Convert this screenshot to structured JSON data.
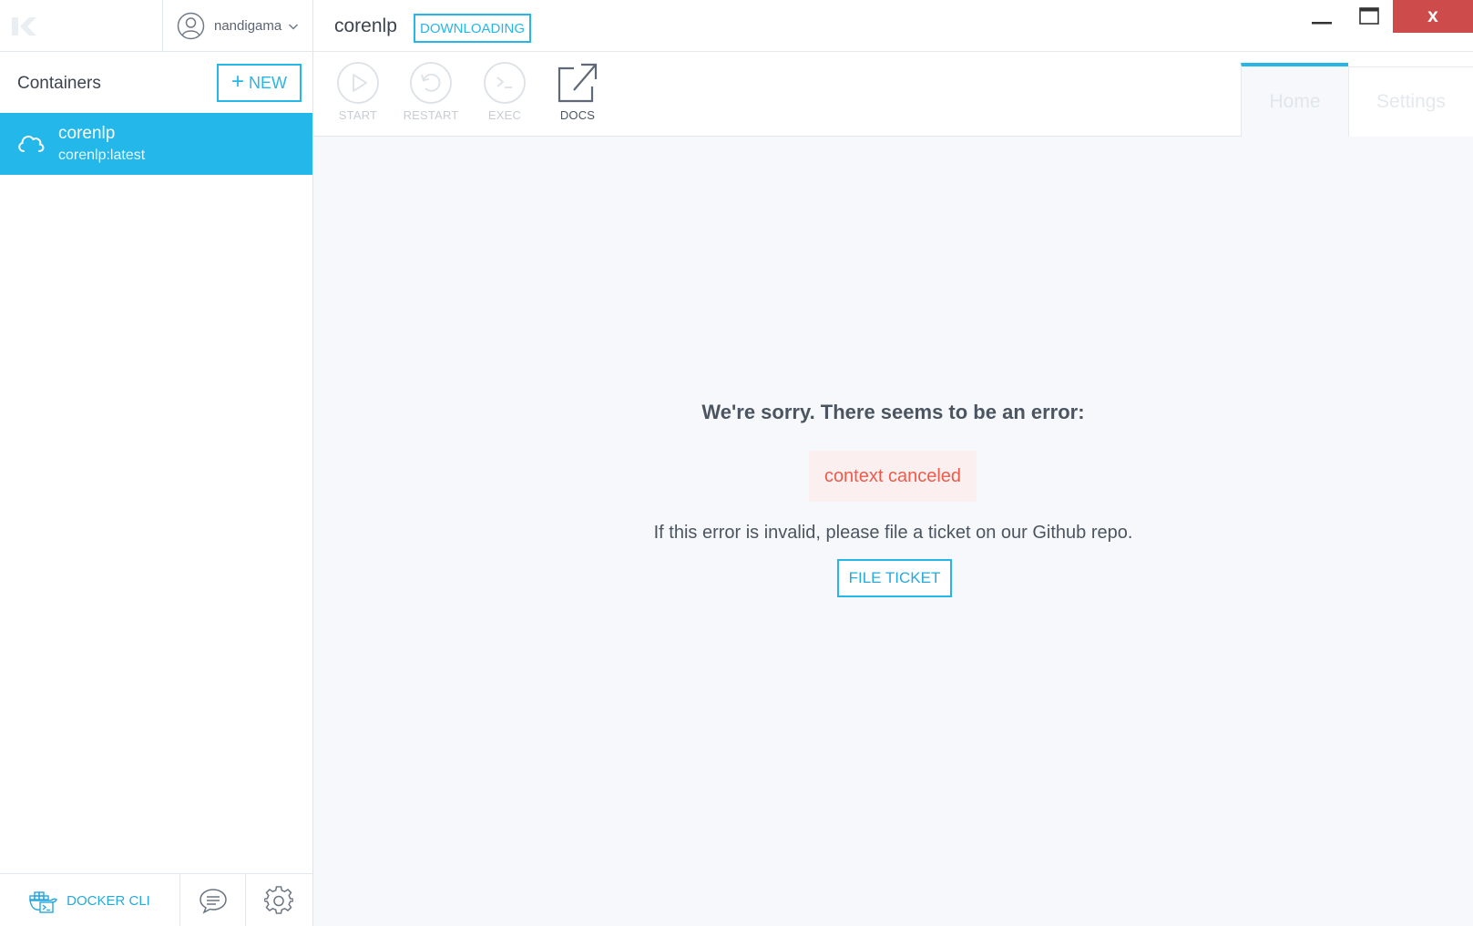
{
  "app": {
    "logo_text": "K"
  },
  "account": {
    "username": "nandigama"
  },
  "sidebar": {
    "title": "Containers",
    "new_button": {
      "plus": "+",
      "label": "NEW"
    },
    "containers": [
      {
        "name": "corenlp",
        "image": "corenlp:latest"
      }
    ],
    "footer": {
      "docker_cli_label": "DOCKER CLI"
    }
  },
  "header": {
    "container_name": "corenlp",
    "status": "DOWNLOADING",
    "window": {
      "close_glyph": "x"
    }
  },
  "toolbar": {
    "actions": [
      {
        "label": "START"
      },
      {
        "label": "RESTART"
      },
      {
        "label": "EXEC"
      },
      {
        "label": "DOCS"
      }
    ],
    "tabs": [
      {
        "label": "Home"
      },
      {
        "label": "Settings"
      }
    ]
  },
  "error": {
    "heading": "We're sorry. There seems to be an error:",
    "message": "context canceled",
    "hint": "If this error is invalid, please file a ticket on our Github repo.",
    "button_label": "FILE TICKET"
  },
  "colors": {
    "accent": "#24b7ea",
    "error_text": "#ef5b4b",
    "close_button": "#cd4b4b"
  }
}
